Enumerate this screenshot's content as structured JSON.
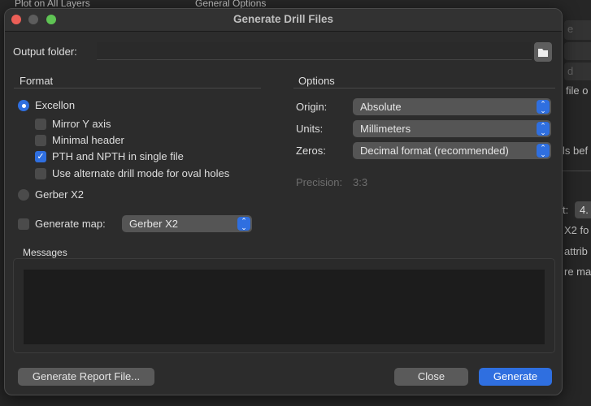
{
  "background": {
    "top_texts": [
      "Plot on All Layers",
      "General Options"
    ],
    "right_fragments": [
      "e",
      "d",
      "file o",
      "ls bef",
      "t:",
      "4.",
      "X2 fo",
      "attrib",
      "re ma"
    ]
  },
  "dialog": {
    "title": "Generate Drill Files",
    "output_folder": {
      "label": "Output folder:",
      "value": ""
    },
    "format": {
      "heading": "Format",
      "excellon": {
        "label": "Excellon",
        "selected": true
      },
      "options": [
        {
          "label": "Mirror Y axis",
          "checked": false
        },
        {
          "label": "Minimal header",
          "checked": false
        },
        {
          "label": "PTH and NPTH in single file",
          "checked": true
        },
        {
          "label": "Use alternate drill mode for oval holes",
          "checked": false
        }
      ],
      "gerber": {
        "label": "Gerber X2",
        "selected": false
      },
      "generate_map": {
        "label": "Generate map:",
        "checked": false,
        "value": "Gerber X2"
      }
    },
    "options": {
      "heading": "Options",
      "origin": {
        "label": "Origin:",
        "value": "Absolute"
      },
      "units": {
        "label": "Units:",
        "value": "Millimeters"
      },
      "zeros": {
        "label": "Zeros:",
        "value": "Decimal format (recommended)"
      },
      "precision": {
        "label": "Precision:",
        "value": "3:3"
      }
    },
    "messages": {
      "label": "Messages",
      "content": ""
    },
    "buttons": {
      "report": "Generate Report File...",
      "close": "Close",
      "generate": "Generate"
    },
    "colors": {
      "accent": "#2f6fe0",
      "close_light": "#ec5f57",
      "min_light": "#5d5d5d",
      "max_light": "#5fc454"
    }
  }
}
